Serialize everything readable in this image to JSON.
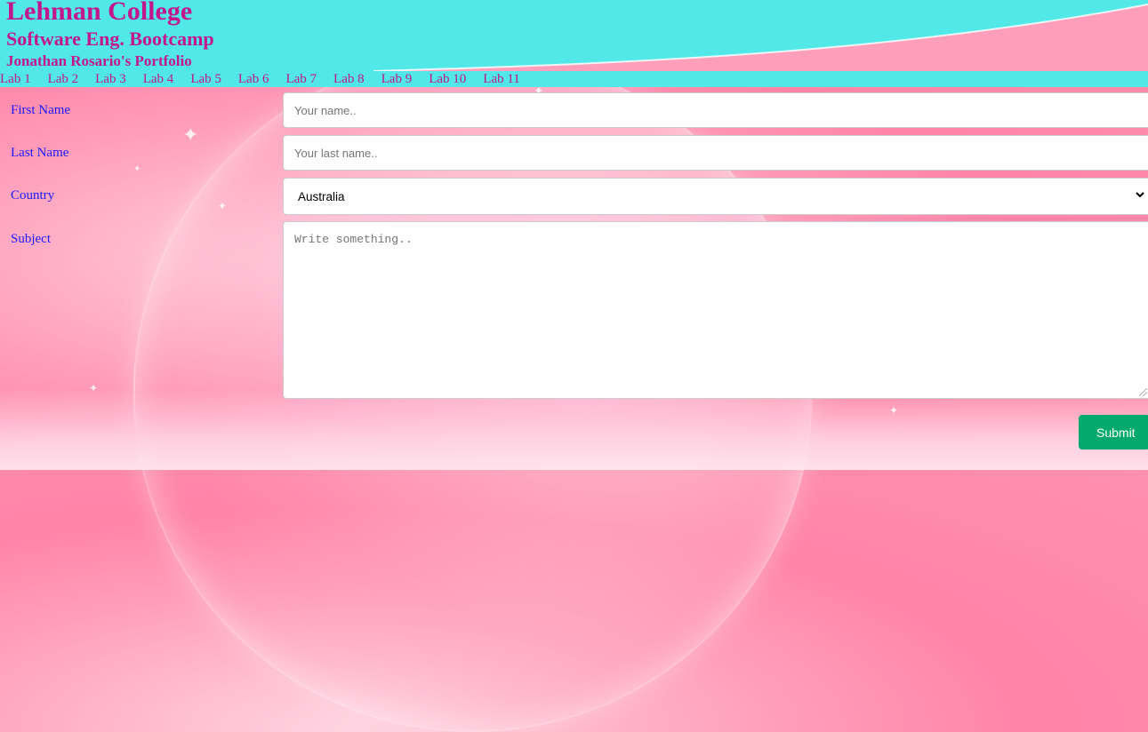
{
  "header": {
    "title": "Lehman College",
    "subtitle": "Software Eng. Bootcamp",
    "portfolio": "Jonathan Rosario's Portfolio"
  },
  "nav": {
    "items": [
      "Lab 1",
      "Lab 2",
      "Lab 3",
      "Lab 4",
      "Lab 5",
      "Lab 6",
      "Lab 7",
      "Lab 8",
      "Lab 9",
      "Lab 10",
      "Lab 11"
    ]
  },
  "form": {
    "first_name_label": "First Name",
    "first_name_placeholder": "Your name..",
    "last_name_label": "Last Name",
    "last_name_placeholder": "Your last name..",
    "country_label": "Country",
    "country_value": "Australia",
    "subject_label": "Subject",
    "subject_placeholder": "Write something..",
    "submit_label": "Submit"
  },
  "colors": {
    "header_bg": "#52e8e8",
    "title_text": "#c1168c",
    "label_text": "#1a1aff",
    "submit_bg": "#04aa6d",
    "page_bg": "#ff90b0"
  },
  "icons": {
    "select_arrow": "chevron-down-icon"
  }
}
